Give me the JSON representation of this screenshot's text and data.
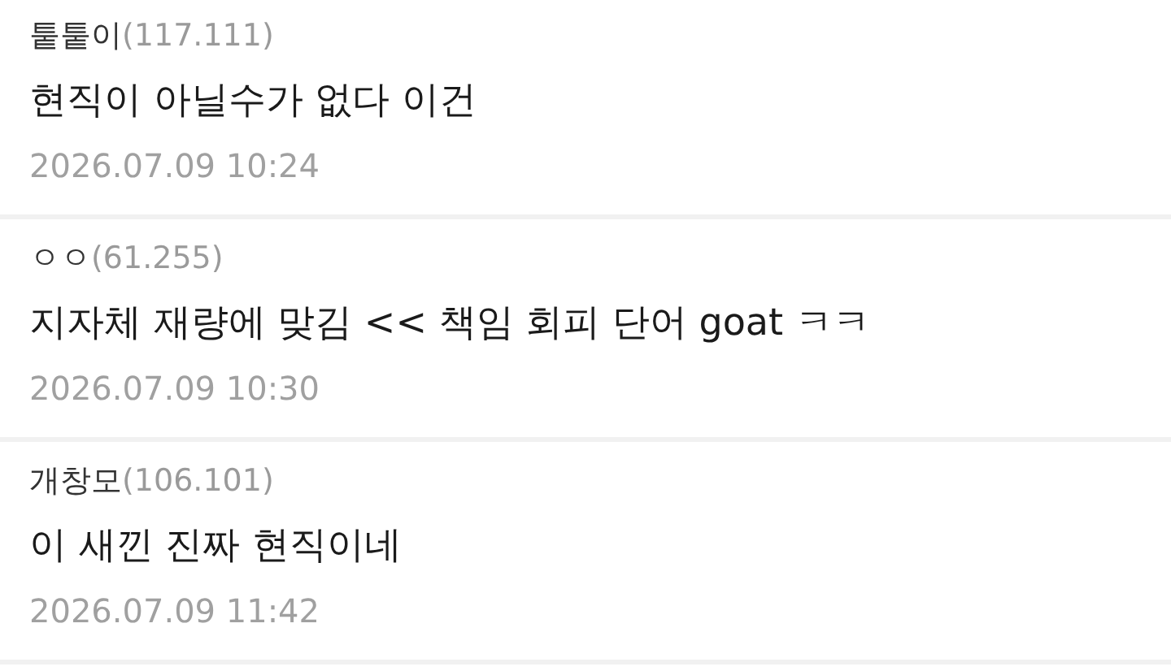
{
  "comments": [
    {
      "author": "퉅퉅이",
      "ip": "(117.111)",
      "text": "현직이 아닐수가 없다 이건",
      "date": "2026.07.09 10:24"
    },
    {
      "author": "ㅇㅇ",
      "ip": "(61.255)",
      "text": "지자체 재량에 맞김 << 책임 회피 단어 goat ㅋㅋ",
      "date": "2026.07.09 10:30"
    },
    {
      "author": "개창모",
      "ip": "(106.101)",
      "text": "이 새낀 진짜 현직이네",
      "date": "2026.07.09 11:42"
    }
  ]
}
